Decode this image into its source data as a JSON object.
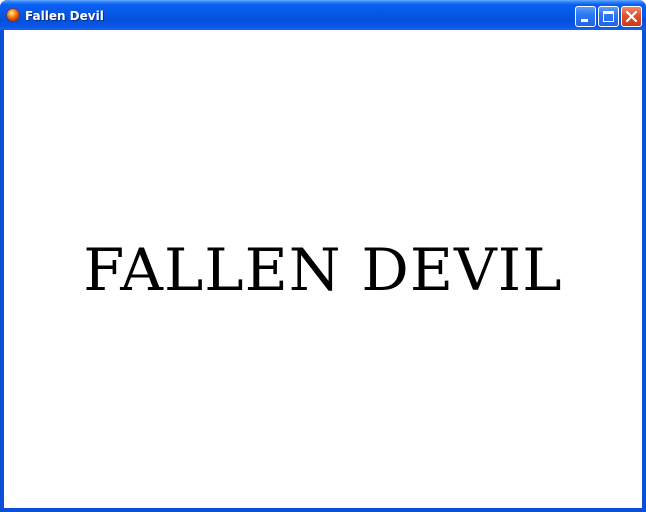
{
  "window": {
    "title": "Fallen Devil",
    "app_icon": "orange-ball-icon",
    "controls": {
      "minimize_icon": "minimize-icon",
      "maximize_icon": "maximize-icon",
      "close_icon": "close-icon"
    }
  },
  "main": {
    "banner_text": "FALLEN DEVIL"
  },
  "colors": {
    "titlebar": "#0657e6",
    "frame": "#0a4fd6",
    "close_button": "#e0512f",
    "background": "#ffffff",
    "text": "#000000"
  }
}
